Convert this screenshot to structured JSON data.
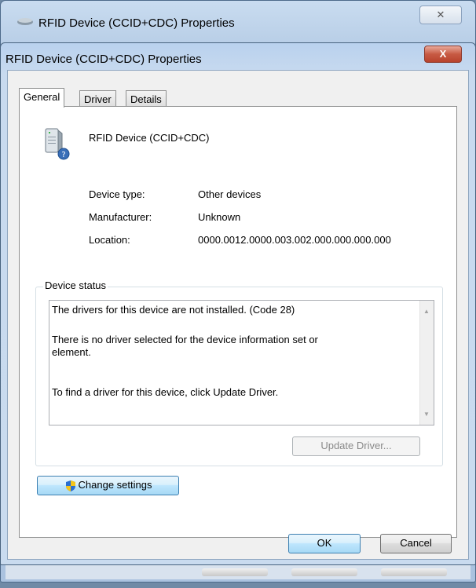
{
  "outer_window": {
    "title": "RFID Device (CCID+CDC) Properties",
    "close_label": "✕"
  },
  "dialog": {
    "title": "RFID Device (CCID+CDC) Properties",
    "close_label": "X"
  },
  "tabs": [
    {
      "label": "General",
      "active": true
    },
    {
      "label": "Driver",
      "active": false
    },
    {
      "label": "Details",
      "active": false
    }
  ],
  "device": {
    "name": "RFID Device (CCID+CDC)",
    "icon": "unknown-device-icon"
  },
  "properties": [
    {
      "label": "Device type:",
      "value": "Other devices"
    },
    {
      "label": "Manufacturer:",
      "value": "Unknown"
    },
    {
      "label": "Location:",
      "value": "0000.0012.0000.003.002.000.000.000.000"
    }
  ],
  "device_status": {
    "legend": "Device status",
    "lines": [
      "The drivers for this device are not installed. (Code 28)",
      "There is no driver selected for the device information set or",
      "element.",
      "To find a driver for this device, click Update Driver."
    ]
  },
  "buttons": {
    "update_driver": "Update Driver...",
    "change_settings": "Change settings",
    "ok": "OK",
    "cancel": "Cancel"
  },
  "colors": {
    "accent": "#3c7fb1",
    "close_red": "#c75a43"
  }
}
